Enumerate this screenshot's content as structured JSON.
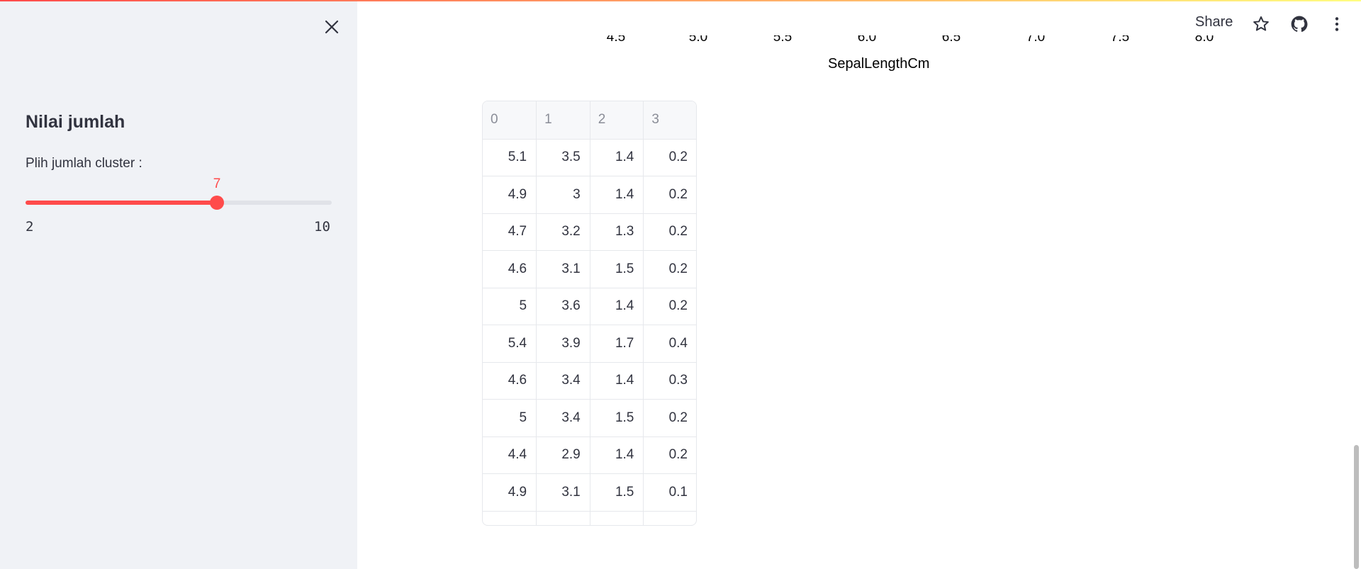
{
  "sidebar": {
    "title": "Nilai jumlah",
    "slider": {
      "label": "Plih jumlah cluster :",
      "value": 7,
      "min": 2,
      "max": 10
    }
  },
  "header": {
    "share_label": "Share",
    "icons": [
      "star-icon",
      "github-icon",
      "more-vert-icon"
    ]
  },
  "chart_fragment": {
    "xlabel": "SepalLengthCm",
    "tick_labels": [
      "4.5",
      "5.0",
      "5.5",
      "6.0",
      "6.5",
      "7.0",
      "7.5",
      "8.0"
    ]
  },
  "dataframe": {
    "columns": [
      "0",
      "1",
      "2",
      "3"
    ],
    "rows": [
      [
        "5.1",
        "3.5",
        "1.4",
        "0.2"
      ],
      [
        "4.9",
        "3",
        "1.4",
        "0.2"
      ],
      [
        "4.7",
        "3.2",
        "1.3",
        "0.2"
      ],
      [
        "4.6",
        "3.1",
        "1.5",
        "0.2"
      ],
      [
        "5",
        "3.6",
        "1.4",
        "0.2"
      ],
      [
        "5.4",
        "3.9",
        "1.7",
        "0.4"
      ],
      [
        "4.6",
        "3.4",
        "1.4",
        "0.3"
      ],
      [
        "5",
        "3.4",
        "1.5",
        "0.2"
      ],
      [
        "4.4",
        "2.9",
        "1.4",
        "0.2"
      ],
      [
        "4.9",
        "3.1",
        "1.5",
        "0.1"
      ]
    ]
  },
  "colors": {
    "accent": "#ff4b4b",
    "sidebar_bg": "#f0f2f6",
    "text": "#31333f"
  }
}
